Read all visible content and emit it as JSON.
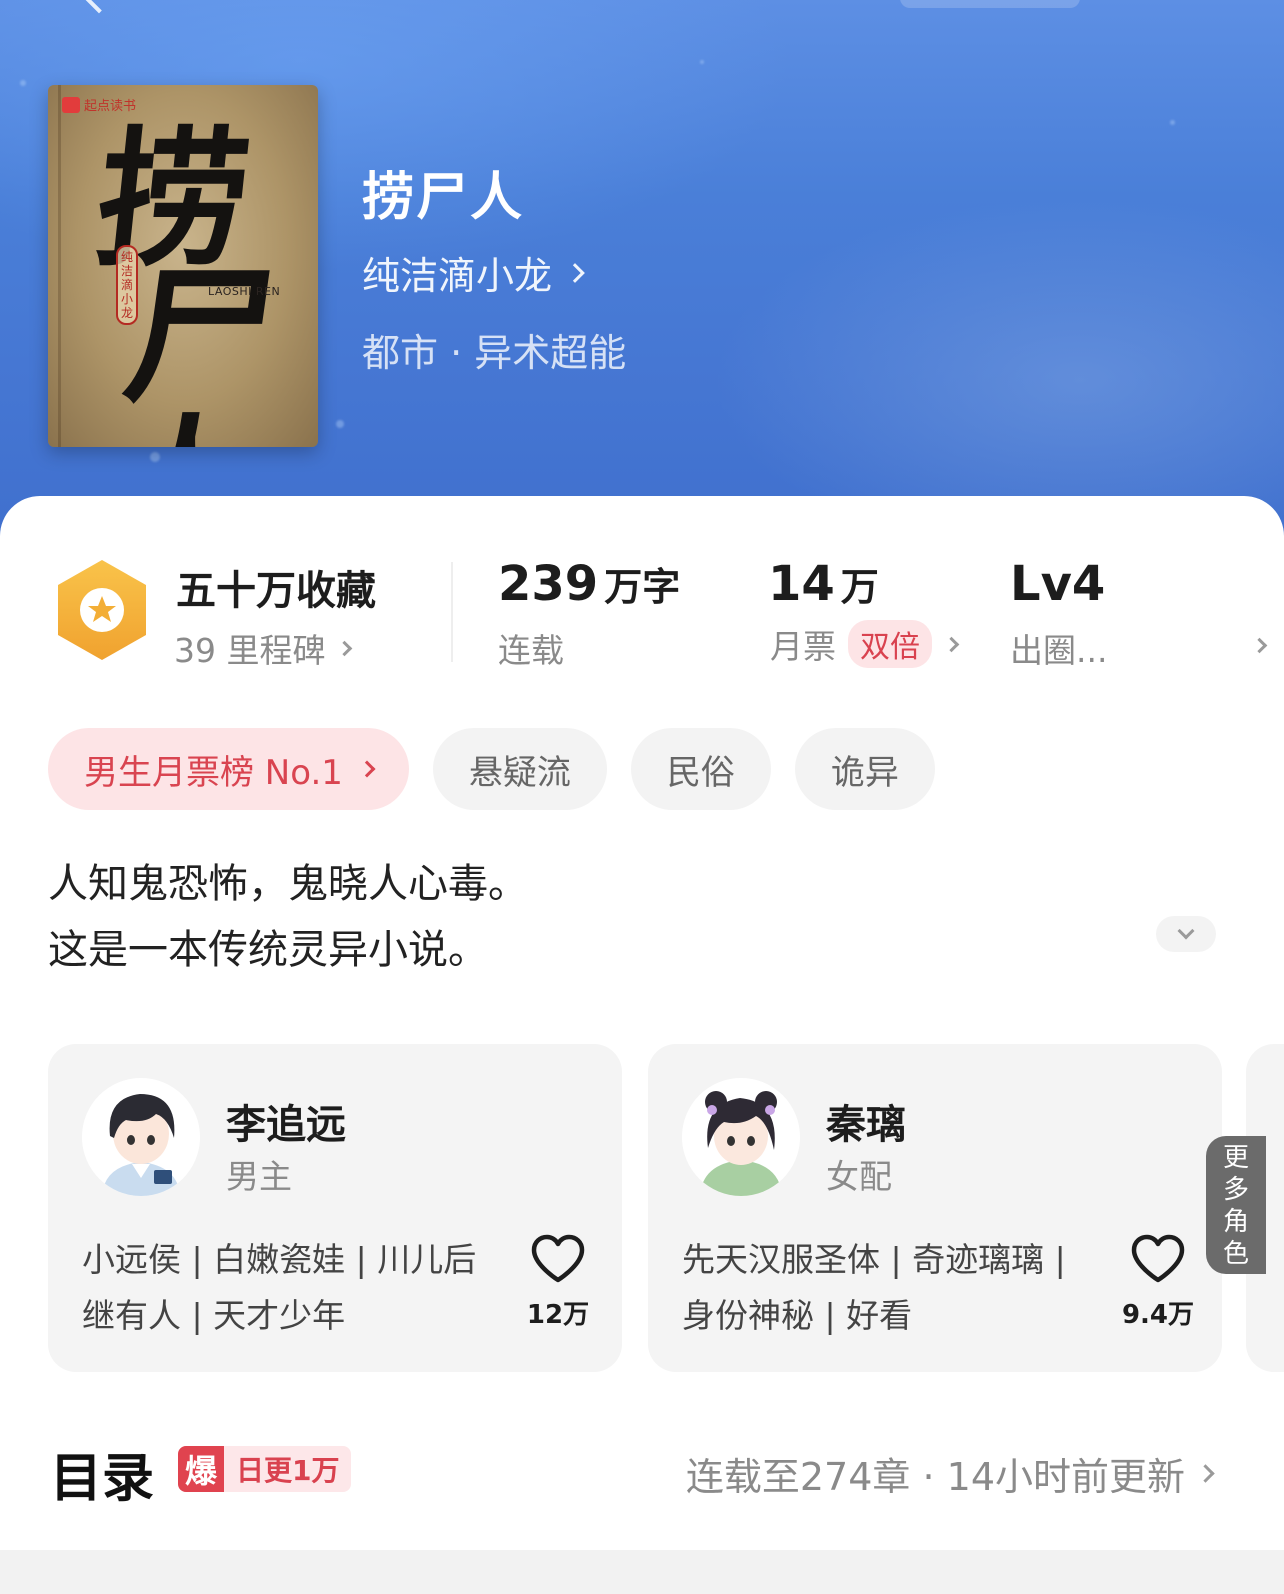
{
  "book": {
    "title": "捞尸人",
    "author": "纯洁滴小龙",
    "genre": "都市 · 异术超能",
    "cover": {
      "publisher": "起点读书",
      "title_chars": [
        "捞",
        "尸人"
      ],
      "author_seal": "纯洁滴小龙",
      "pinyin": "LAOSHI REN"
    }
  },
  "stats": {
    "favorites": {
      "main": "五十万收藏",
      "sub": "39 里程碑"
    },
    "words": {
      "number": "239",
      "unit": "万字",
      "label": "连载"
    },
    "tickets": {
      "number": "14",
      "unit": "万",
      "label": "月票",
      "badge": "双倍"
    },
    "level": {
      "number": "Lv4",
      "label": "出圈..."
    }
  },
  "tags": {
    "rank": "男生月票榜 No.1",
    "items": [
      "悬疑流",
      "民俗",
      "诡异"
    ]
  },
  "description": {
    "line1": "人知鬼恐怖，鬼晓人心毒。",
    "line2": "这是一本传统灵异小说。"
  },
  "characters": [
    {
      "name": "李追远",
      "role": "男主",
      "traits_line1": "小远侯 | 白嫩瓷娃 | 川儿后",
      "traits_line2": "继有人 | 天才少年",
      "likes": "12万"
    },
    {
      "name": "秦璃",
      "role": "女配",
      "traits_line1": "先天汉服圣体 | 奇迹璃璃 |",
      "traits_line2": "身份神秘 | 好看",
      "likes": "9.4万"
    }
  ],
  "more_characters": "更多角色",
  "toc": {
    "title": "目录",
    "badge_icon": "爆",
    "badge_text": "日更1万",
    "status": "连载至274章 · 14小时前更新"
  },
  "colors": {
    "hero": "#4a7fd8",
    "accent_red": "#d94450",
    "badge_bg": "#fde4e6",
    "medal": "#f5b53f"
  }
}
